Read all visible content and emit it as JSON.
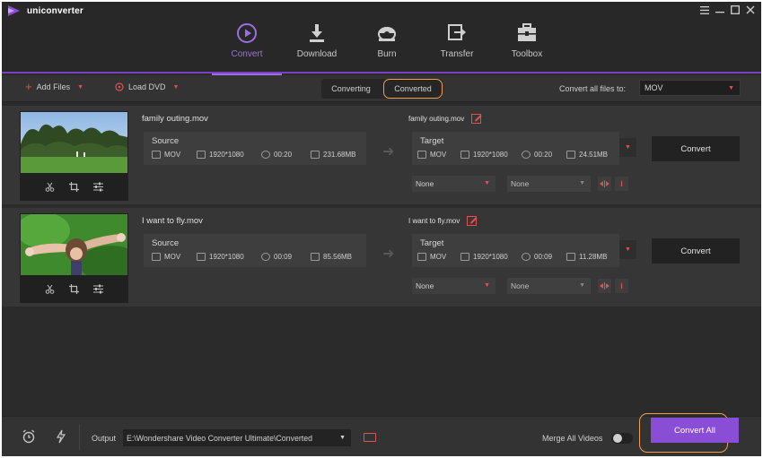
{
  "app": {
    "title": "uniconverter",
    "brand_color": "#8a4ed6",
    "highlight_color": "#f0a04b"
  },
  "nav": [
    {
      "label": "Convert",
      "icon": "play-circle-icon",
      "active": true
    },
    {
      "label": "Download",
      "icon": "download-icon",
      "active": false
    },
    {
      "label": "Burn",
      "icon": "disc-icon",
      "active": false
    },
    {
      "label": "Transfer",
      "icon": "transfer-icon",
      "active": false
    },
    {
      "label": "Toolbox",
      "icon": "toolbox-icon",
      "active": false
    }
  ],
  "toolbar": {
    "add_files": "Add Files",
    "load_dvd": "Load DVD",
    "tabs": [
      "Converting",
      "Converted"
    ],
    "active_tab": "Converted",
    "convert_all_label": "Convert all files to:",
    "format": "MOV"
  },
  "files": [
    {
      "name": "family outing.mov",
      "target_name": "family outing.mov",
      "source": {
        "title": "Source",
        "format": "MOV",
        "resolution": "1920*1080",
        "duration": "00:20",
        "size": "231.68MB"
      },
      "target": {
        "title": "Target",
        "format": "MOV",
        "resolution": "1920*1080",
        "duration": "00:20",
        "size": "24.51MB"
      },
      "convert_label": "Convert",
      "subtitle": "None",
      "audio": "None"
    },
    {
      "name": "I want to fly.mov",
      "target_name": "I want to fly.mov",
      "source": {
        "title": "Source",
        "format": "MOV",
        "resolution": "1920*1080",
        "duration": "00:09",
        "size": "85.56MB"
      },
      "target": {
        "title": "Target",
        "format": "MOV",
        "resolution": "1920*1080",
        "duration": "00:09",
        "size": "11.28MB"
      },
      "convert_label": "Convert",
      "subtitle": "None",
      "audio": "None"
    }
  ],
  "bottom": {
    "output_label": "Output",
    "output_path": "E:\\Wondershare Video Converter Ultimate\\Converted",
    "merge_label": "Merge All Videos",
    "merge_on": false,
    "convert_all": "Convert All"
  }
}
